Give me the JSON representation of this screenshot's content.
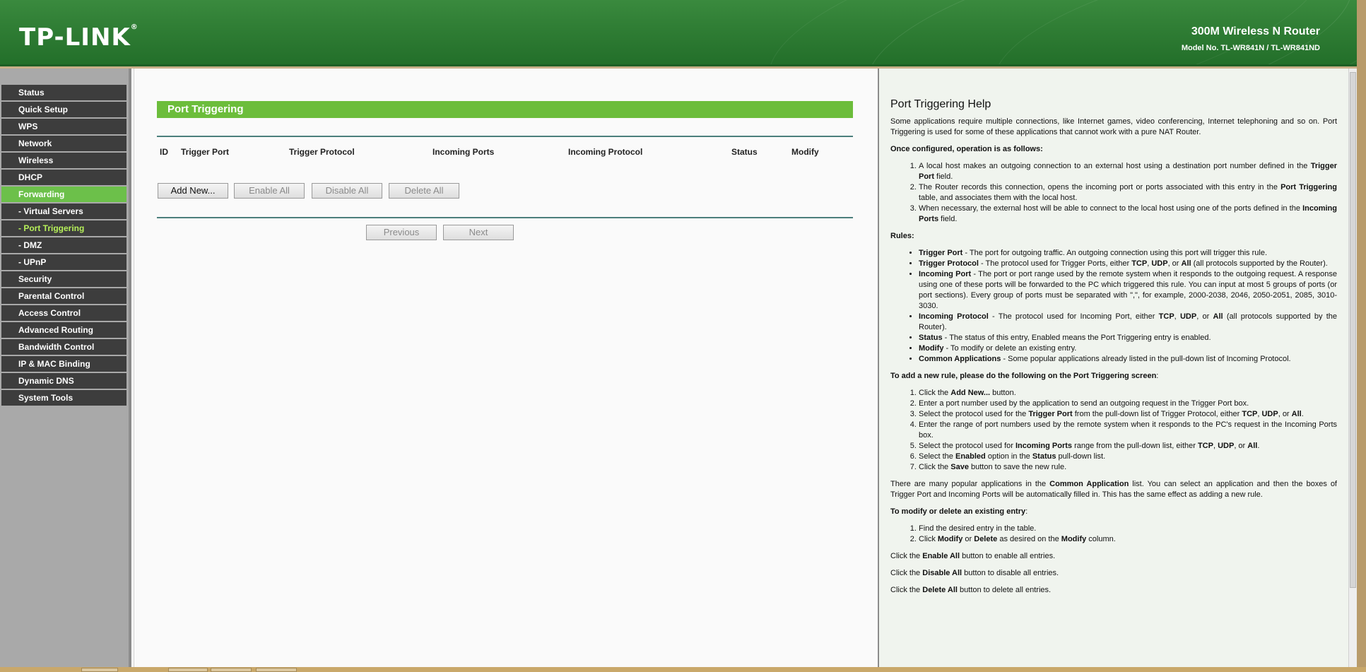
{
  "header": {
    "logo": "TP-LINK",
    "logo_reg": "®",
    "product": "300M Wireless N Router",
    "model": "Model No. TL-WR841N / TL-WR841ND"
  },
  "sidebar": {
    "items": [
      {
        "label": "Status"
      },
      {
        "label": "Quick Setup"
      },
      {
        "label": "WPS"
      },
      {
        "label": "Network"
      },
      {
        "label": "Wireless"
      },
      {
        "label": "DHCP"
      },
      {
        "label": "Forwarding"
      },
      {
        "label": "- Virtual Servers"
      },
      {
        "label": "- Port Triggering"
      },
      {
        "label": "- DMZ"
      },
      {
        "label": "- UPnP"
      },
      {
        "label": "Security"
      },
      {
        "label": "Parental Control"
      },
      {
        "label": "Access Control"
      },
      {
        "label": "Advanced Routing"
      },
      {
        "label": "Bandwidth Control"
      },
      {
        "label": "IP & MAC Binding"
      },
      {
        "label": "Dynamic DNS"
      },
      {
        "label": "System Tools"
      }
    ]
  },
  "main": {
    "title": "Port Triggering",
    "columns": [
      "ID",
      "Trigger Port",
      "Trigger Protocol",
      "Incoming Ports",
      "Incoming Protocol",
      "Status",
      "Modify"
    ],
    "buttons": {
      "add_new": "Add New...",
      "enable_all": "Enable All",
      "disable_all": "Disable All",
      "delete_all": "Delete All",
      "previous": "Previous",
      "next": "Next"
    }
  },
  "help": {
    "title": "Port Triggering Help",
    "intro": "Some applications require multiple connections, like Internet games, video conferencing, Internet telephoning and so on. Port Triggering is used for some of these applications that cannot work with a pure NAT Router.",
    "once_configured": "Once configured, operation is as follows:",
    "op1_a": "A local host makes an outgoing connection to an external host using a destination port number defined in the ",
    "op1_b": "Trigger Port",
    "op1_c": " field.",
    "op2_a": "The Router records this connection, opens the incoming port or ports associated with this entry in the ",
    "op2_b": "Port Triggering",
    "op2_c": " table, and associates them with the local host.",
    "op3_a": "When necessary, the external host will be able to connect to the local host using one of the ports defined in the ",
    "op3_b": "Incoming Ports",
    "op3_c": " field.",
    "rules_label": "Rules:",
    "r1_b": "Trigger Port",
    "r1_t": " - The port for outgoing traffic. An outgoing connection using this port will trigger this rule.",
    "r2_b": "Trigger Protocol",
    "r2_t1": " - The protocol used for Trigger Ports, either ",
    "r2_tcp": "TCP",
    "r2_sep": ", ",
    "r2_udp": "UDP",
    "r2_or": ", or ",
    "r2_all": "All",
    "r2_t2": " (all protocols supported by the Router).",
    "r3_b": "Incoming Port",
    "r3_t": " - The port or port range used by the remote system when it responds to the outgoing request. A response using one of these ports will be forwarded to the PC which triggered this rule. You can input at most 5 groups of ports (or port sections). Every group of ports must be separated with \",\", for example, 2000-2038, 2046, 2050-2051, 2085, 3010-3030.",
    "r4_b": "Incoming Protocol",
    "r4_t1": " - The protocol used for Incoming Port, either ",
    "r4_tcp": "TCP",
    "r4_sep": ", ",
    "r4_udp": "UDP",
    "r4_or": ", or ",
    "r4_all": "All",
    "r4_t2": " (all protocols supported by the Router).",
    "r5_b": "Status",
    "r5_t": " - The status of this entry, Enabled means the Port Triggering entry is enabled.",
    "r6_b": "Modify",
    "r6_t": " - To modify or delete an existing entry.",
    "r7_b": "Common Applications",
    "r7_t": " - Some popular applications already listed in the pull-down list of Incoming Protocol.",
    "add_rule_a": "To add a new rule, please do the following on the Port Triggering screen",
    "add_rule_b": ":",
    "s1_a": "Click the ",
    "s1_b": "Add New...",
    "s1_c": " button.",
    "s2": "Enter a port number used by the application to send an outgoing request in the Trigger Port box.",
    "s3_a": "Select the protocol used for the ",
    "s3_b": "Trigger Port",
    "s3_c": " from the pull-down list of Trigger Protocol, either ",
    "s3_tcp": "TCP",
    "s3_sep": ", ",
    "s3_udp": "UDP",
    "s3_or": ", or ",
    "s3_all": "All",
    "s3_end": ".",
    "s4": "Enter the range of port numbers used by the remote system when it responds to the PC's request in the Incoming Ports box.",
    "s5_a": "Select the protocol used for ",
    "s5_b": "Incoming Ports",
    "s5_c": " range from the pull-down list, either ",
    "s5_tcp": "TCP",
    "s5_sep": ", ",
    "s5_udp": "UDP",
    "s5_or": ", or ",
    "s5_all": "All",
    "s5_end": ".",
    "s6_a": "Select the ",
    "s6_b": "Enabled",
    "s6_c": " option in the ",
    "s6_d": "Status",
    "s6_e": " pull-down list.",
    "s7_a": "Click the ",
    "s7_b": "Save",
    "s7_c": " button to save the new rule.",
    "common_a": "There are many popular applications in the ",
    "common_b": "Common Application",
    "common_c": " list. You can select an application and then the boxes of Trigger Port and Incoming Ports will be automatically filled in. This has the same effect as adding a new rule.",
    "modify_a": "To modify or delete an existing entry",
    "modify_b": ":",
    "m1": "Find the desired entry in the table.",
    "m2_a": "Click ",
    "m2_b": "Modify",
    "m2_c": " or ",
    "m2_d": "Delete",
    "m2_e": " as desired on the ",
    "m2_f": "Modify",
    "m2_g": " column.",
    "ea_a": "Click the ",
    "ea_b": "Enable All",
    "ea_c": " button to enable all entries.",
    "da_a": "Click the ",
    "da_b": "Disable All",
    "da_c": " button to disable all entries.",
    "dl_a": "Click the ",
    "dl_b": "Delete All",
    "dl_c": " button to delete all entries."
  },
  "colors": {
    "header_green": "#2f7d34",
    "active_green": "#6cc04a",
    "title_green": "#6cbd3b",
    "menu_dark": "#3d3d3d",
    "sub_active_text": "#b6f05a"
  }
}
